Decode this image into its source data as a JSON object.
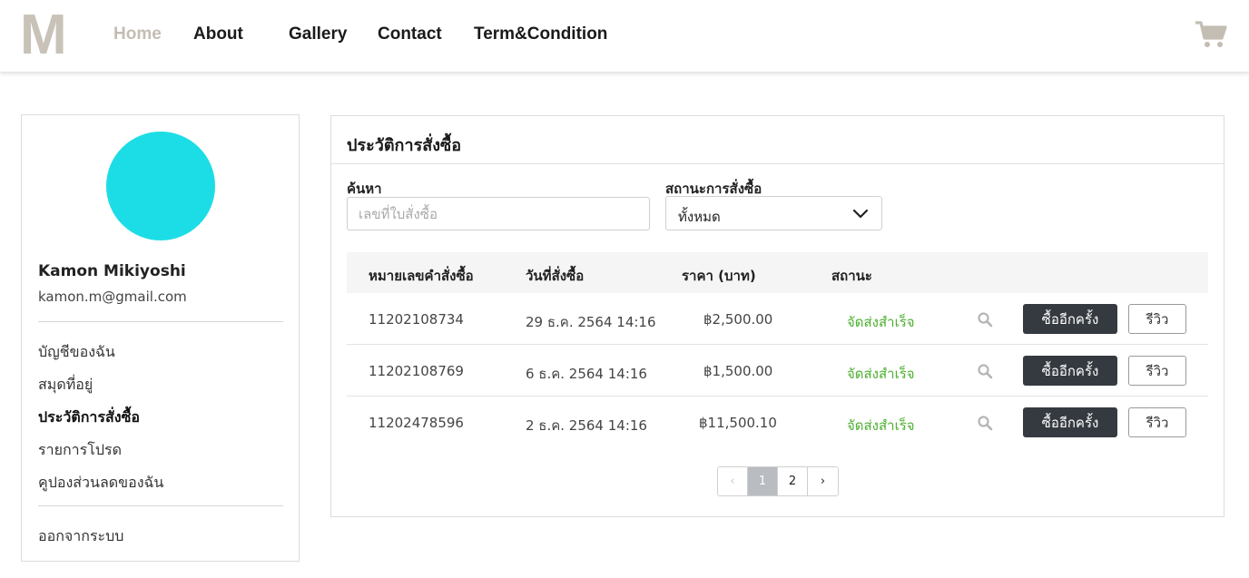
{
  "brand": {
    "logo_text": "M",
    "logo_color": "#c8c2b8"
  },
  "nav": {
    "items": [
      {
        "label": "Home",
        "active": true
      },
      {
        "label": "About"
      },
      {
        "label": "Gallery"
      },
      {
        "label": "Contact"
      },
      {
        "label": "Term&Condition"
      }
    ],
    "cart_icon": "shopping-cart-icon"
  },
  "sidebar": {
    "avatar_color": "#1cdde6",
    "user_name": "Kamon Mikiyoshi",
    "user_email": "kamon.m@gmail.com",
    "menu": [
      {
        "label": "บัญชีของฉัน"
      },
      {
        "label": "สมุดที่อยู่"
      },
      {
        "label": "ประวัติการสั่งซื้อ",
        "active": true
      },
      {
        "label": "รายการโปรด"
      },
      {
        "label": "คูปองส่วนลดของฉัน"
      }
    ],
    "logout_label": "ออกจากระบบ"
  },
  "orders": {
    "title": "ประวัติการสั่งซื้อ",
    "search": {
      "label": "ค้นหา",
      "placeholder": "เลขที่ใบสั่งซื้อ",
      "value": ""
    },
    "status_filter": {
      "label": "สถานะการสั่งซื้อ",
      "selected": "ทั้งหมด"
    },
    "columns": [
      "หมายเลขคำสั่งซื้อ",
      "วันที่สั่งซื้อ",
      "ราคา (บาท)",
      "สถานะ"
    ],
    "rows": [
      {
        "order_no": "11202108734",
        "date": "29 ธ.ค. 2564 14:16",
        "price": "฿2,500.00",
        "status": "จัดส่งสำเร็จ"
      },
      {
        "order_no": "11202108769",
        "date": "6 ธ.ค. 2564 14:16",
        "price": "฿1,500.00",
        "status": "จัดส่งสำเร็จ"
      },
      {
        "order_no": "11202478596",
        "date": "2 ธ.ค. 2564 14:16",
        "price": "฿11,500.10",
        "status": "จัดส่งสำเร็จ"
      }
    ],
    "rebuy_label": "ซื้ออีกครั้ง",
    "review_label": "รีวิว",
    "status_color": "#4caf2f",
    "pagination": {
      "prev": "‹",
      "pages": [
        "1",
        "2"
      ],
      "current": "1",
      "next": "›"
    }
  }
}
